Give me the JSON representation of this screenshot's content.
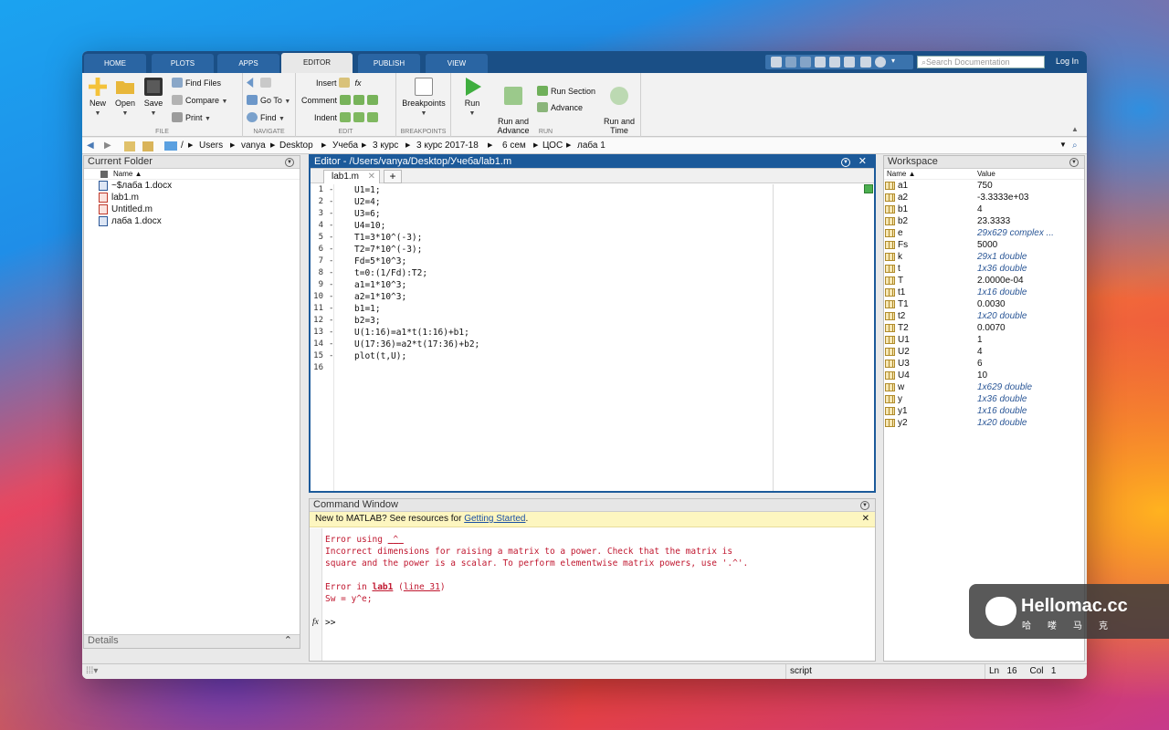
{
  "tabs": [
    "HOME",
    "PLOTS",
    "APPS",
    "EDITOR",
    "PUBLISH",
    "VIEW"
  ],
  "search_placeholder": "Search Documentation",
  "login": "Log In",
  "ribbon": {
    "file": {
      "new": "New",
      "open": "Open",
      "save": "Save",
      "find_files": "Find Files",
      "compare": "Compare",
      "print": "Print",
      "label": "FILE"
    },
    "navigate": {
      "goto": "Go To",
      "find": "Find",
      "label": "NAVIGATE"
    },
    "edit": {
      "insert": "Insert",
      "comment": "Comment",
      "indent": "Indent",
      "label": "EDIT",
      "fx": "fx"
    },
    "breakpoints": {
      "button": "Breakpoints",
      "label": "BREAKPOINTS"
    },
    "run": {
      "run": "Run",
      "run_advance": "Run and\nAdvance",
      "run_section": "Run Section",
      "advance": "Advance",
      "run_time": "Run and\nTime",
      "label": "RUN"
    }
  },
  "path": [
    "/",
    "Users",
    "vanya",
    "Desktop",
    "Учеба",
    "3 курс",
    "3 курс 2017-18",
    "6 сем",
    "ЦОС",
    "лаба 1"
  ],
  "current_folder": {
    "title": "Current Folder",
    "name_header": "Name ▲",
    "files": [
      "~$лаба 1.docx",
      "lab1.m",
      "Untitled.m",
      "лаба 1.docx"
    ]
  },
  "details": "Details",
  "editor": {
    "title": "Editor - /Users/vanya/Desktop/Учеба/lab1.m",
    "tab": "lab1.m",
    "plus": "+",
    "lines": [
      "U1=1;",
      "U2=4;",
      "U3=6;",
      "U4=10;",
      "T1=3*10^(-3);",
      "T2=7*10^(-3);",
      "Fd=5*10^3;",
      "t=0:(1/Fd):T2;",
      "a1=1*10^3;",
      "a2=1*10^3;",
      "b1=1;",
      "b2=3;",
      "U(1:16)=a1*t(1:16)+b1;",
      "U(17:36)=a2*t(17:36)+b2;",
      "plot(t,U);",
      ""
    ]
  },
  "command": {
    "title": "Command Window",
    "banner": "New to MATLAB? See resources for ",
    "banner_link": "Getting Started",
    "banner_end": ".",
    "err1_prefix": "Error using ",
    "err1_op": "^",
    "err1_l1": "Incorrect dimensions for raising a matrix to a power. Check that the matrix is",
    "err1_l2": "square and the power is a scalar. To perform elementwise matrix powers, use '.^'.",
    "err2_prefix": "Error in ",
    "err2_fn": "lab1",
    "err2_line": "line 31",
    "err2_open": " (",
    "err2_close": ")",
    "err2_code": "Sw = y^e;",
    "prompt": ">>",
    "fx": "fx"
  },
  "workspace": {
    "title": "Workspace",
    "col_name": "Name ▲",
    "col_value": "Value",
    "vars": [
      {
        "name": "a1",
        "value": "750",
        "italic": false
      },
      {
        "name": "a2",
        "value": "-3.3333e+03",
        "italic": false
      },
      {
        "name": "b1",
        "value": "4",
        "italic": false
      },
      {
        "name": "b2",
        "value": "23.3333",
        "italic": false
      },
      {
        "name": "e",
        "value": "29x629 complex ...",
        "italic": true
      },
      {
        "name": "Fs",
        "value": "5000",
        "italic": false
      },
      {
        "name": "k",
        "value": "29x1 double",
        "italic": true
      },
      {
        "name": "t",
        "value": "1x36 double",
        "italic": true
      },
      {
        "name": "T",
        "value": "2.0000e-04",
        "italic": false
      },
      {
        "name": "t1",
        "value": "1x16 double",
        "italic": true
      },
      {
        "name": "T1",
        "value": "0.0030",
        "italic": false
      },
      {
        "name": "t2",
        "value": "1x20 double",
        "italic": true
      },
      {
        "name": "T2",
        "value": "0.0070",
        "italic": false
      },
      {
        "name": "U1",
        "value": "1",
        "italic": false
      },
      {
        "name": "U2",
        "value": "4",
        "italic": false
      },
      {
        "name": "U3",
        "value": "6",
        "italic": false
      },
      {
        "name": "U4",
        "value": "10",
        "italic": false
      },
      {
        "name": "w",
        "value": "1x629 double",
        "italic": true
      },
      {
        "name": "y",
        "value": "1x36 double",
        "italic": true
      },
      {
        "name": "y1",
        "value": "1x16 double",
        "italic": true
      },
      {
        "name": "y2",
        "value": "1x20 double",
        "italic": true
      }
    ]
  },
  "status": {
    "mode": "script",
    "ln_label": "Ln",
    "ln": "16",
    "col_label": "Col",
    "col": "1"
  },
  "watermark": {
    "title": "Hellomac.cc",
    "sub": "哈　喽　马　克"
  }
}
